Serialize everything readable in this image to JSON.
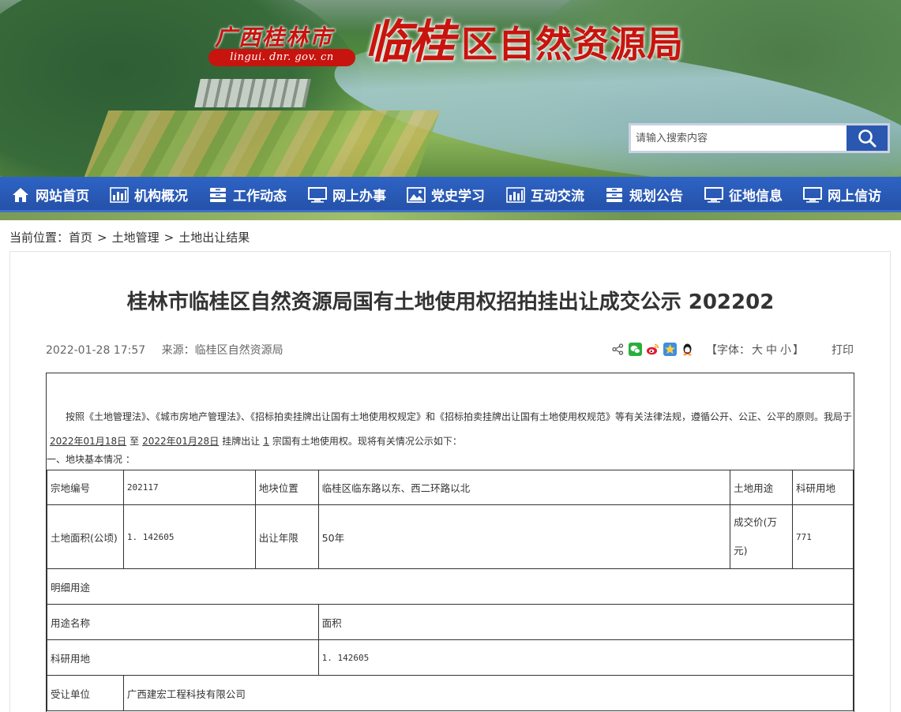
{
  "header": {
    "brand_region": "广西桂林市",
    "brand_domain": "lingui. dnr. gov. cn",
    "brand_name_big": "临桂",
    "brand_name_org": "区自然资源局",
    "search": {
      "placeholder": "请输入搜索内容",
      "icon": "search-icon"
    }
  },
  "nav": {
    "items": [
      {
        "label": "网站首页",
        "icon": "home-icon"
      },
      {
        "label": "机构概况",
        "icon": "bar-chart-icon"
      },
      {
        "label": "工作动态",
        "icon": "archive-icon"
      },
      {
        "label": "网上办事",
        "icon": "monitor-icon"
      },
      {
        "label": "党史学习",
        "icon": "image-icon"
      },
      {
        "label": "互动交流",
        "icon": "bar-chart-icon"
      },
      {
        "label": "规划公告",
        "icon": "archive-icon"
      },
      {
        "label": "征地信息",
        "icon": "monitor-icon"
      },
      {
        "label": "网上信访",
        "icon": "monitor-icon"
      }
    ],
    "colors": {
      "bg": "#2a5bb8",
      "text": "#ffffff"
    }
  },
  "breadcrumb": {
    "prefix": "当前位置：",
    "items": [
      "首页",
      "土地管理",
      "土地出让结果"
    ],
    "separator": ">"
  },
  "article": {
    "title": "桂林市临桂区自然资源局国有土地使用权招拍挂出让成交公示 202202",
    "datetime": "2022-01-28 17:57",
    "source": "来源：临桂区自然资源局",
    "share_icons": [
      "share-icon",
      "wechat-icon",
      "weibo-icon",
      "qzone-icon",
      "qq-icon"
    ],
    "font_size": {
      "open": "【字体：",
      "large": "大",
      "medium": "中",
      "small": "小",
      "close": "】"
    },
    "print_label": "打印",
    "intro": {
      "part1": "按照《土地管理法》、《城市房地产管理法》、《招标拍卖挂牌出让国有土地使用权规定》和《招标拍卖挂牌出让国有土地使用权规范》等有关法律法规，遵循公开、公正、公平的原则。我局于",
      "start_date": "2022年01月18日",
      "to": "至",
      "end_date": "2022年01月28日",
      "part2": "挂牌出让",
      "count": "1",
      "part3": "宗国有土地使用权。现将有关情况公示如下："
    },
    "section1": "一、地块基本情况 ：",
    "table": {
      "parcel_no_label": "宗地编号",
      "parcel_no": "202117",
      "location_label": "地块位置",
      "location": "临桂区临东路以东、西二环路以北",
      "use_label": "土地用途",
      "use": "科研用地",
      "area_label": "土地面积(公顷)",
      "area": "1. 142605",
      "term_label": "出让年限",
      "term": "50年",
      "price_label_1": "成交价(万",
      "price_label_2": "元)",
      "price": "771",
      "detail_use_label": "明细用途",
      "use_name_label": "用途名称",
      "area_col_label": "面积",
      "detail_use_name": "科研用地",
      "detail_area": "1. 142605",
      "buyer_label": "受让单位",
      "buyer": "广西建宏工程科技有限公司"
    }
  }
}
